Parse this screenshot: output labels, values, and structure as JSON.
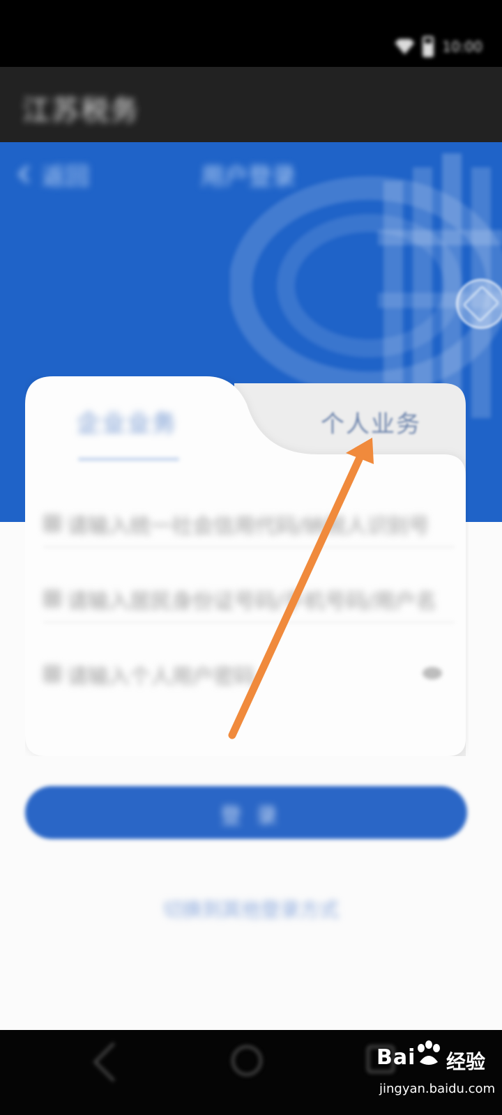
{
  "status_bar": {
    "time": "10:00"
  },
  "app_bar": {
    "title": "江苏税务"
  },
  "header": {
    "back_label": "返回",
    "title": "用户登录"
  },
  "tabs": {
    "company": "企业业务",
    "personal": "个人业务"
  },
  "form": {
    "field1_placeholder": "请输入统一社会信用代码/纳税人识别号",
    "field2_placeholder": "请输入居民身份证号码/手机号码/用户名",
    "field3_placeholder": "请输入个人用户密码"
  },
  "login_button": "登 录",
  "bottom_link": "切换到其他登录方式",
  "watermark": {
    "brand": "Bai",
    "brand2": "经验",
    "url": "jingyan.baidu.com"
  },
  "colors": {
    "header_blue": "#1f63c8",
    "arrow_orange": "#f08a3c",
    "button_blue": "#2a66c6"
  },
  "icons": {
    "wifi": "wifi-icon",
    "battery": "battery-icon",
    "back": "chevron-left-icon",
    "emblem": "tax-emblem-icon",
    "assistant": "assistant-widget-icon",
    "company_field": "company-id-icon",
    "user_field": "user-icon",
    "password_field": "lock-icon",
    "show_password": "eye-icon",
    "nav_back": "nav-back-icon",
    "nav_home": "nav-home-icon",
    "nav_recent": "nav-recent-icon"
  }
}
